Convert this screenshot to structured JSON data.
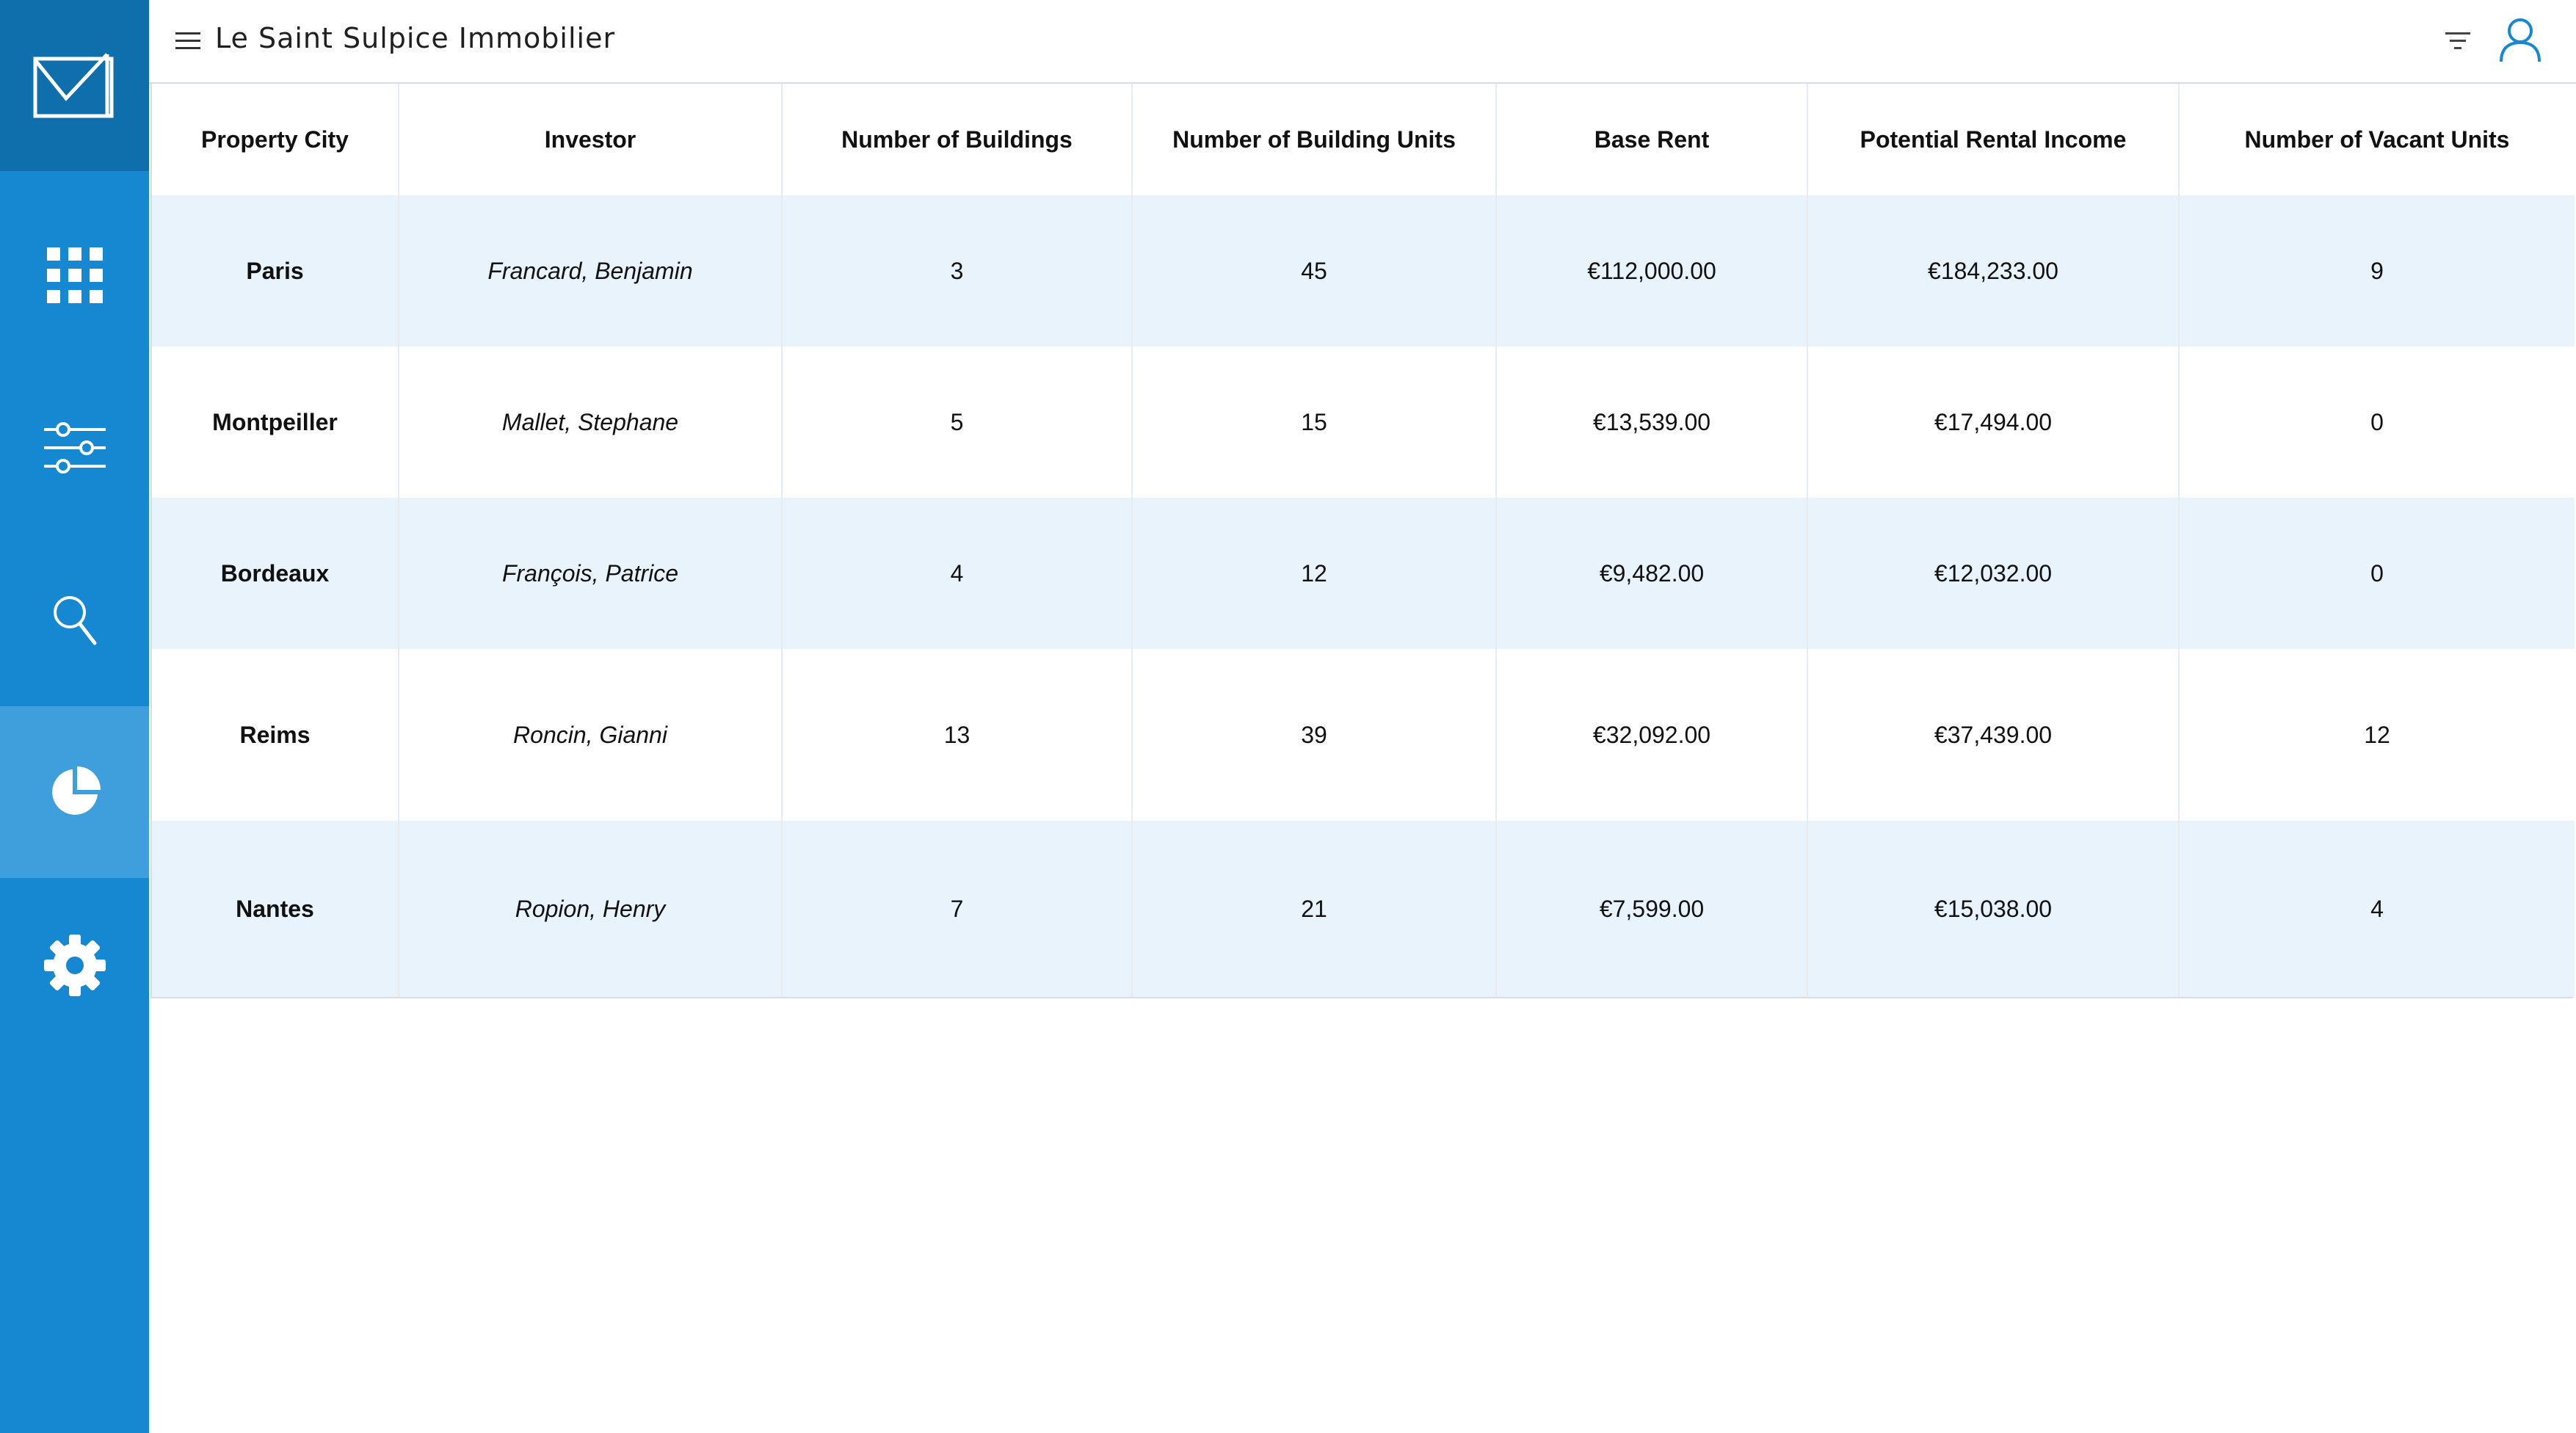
{
  "app": {
    "title": "Le Saint Sulpice Immobilier"
  },
  "sidebar": {
    "items": [
      {
        "name": "apps",
        "icon": "apps-grid-icon"
      },
      {
        "name": "filters",
        "icon": "sliders-icon"
      },
      {
        "name": "search",
        "icon": "search-icon"
      },
      {
        "name": "reports",
        "icon": "pie-chart-icon",
        "active": true
      },
      {
        "name": "settings",
        "icon": "gear-icon"
      }
    ]
  },
  "table": {
    "columns": [
      "Property City",
      "Investor",
      "Number of Buildings",
      "Number of Building Units",
      "Base Rent",
      "Potential Rental Income",
      "Number of Vacant Units"
    ],
    "rows": [
      {
        "city": "Paris",
        "investor": "Francard, Benjamin",
        "buildings": "3",
        "units": "45",
        "base_rent": "€112,000.00",
        "potential_income": "€184,233.00",
        "vacant": "9"
      },
      {
        "city": "Montpeiller",
        "investor": "Mallet, Stephane",
        "buildings": "5",
        "units": "15",
        "base_rent": "€13,539.00",
        "potential_income": "€17,494.00",
        "vacant": "0"
      },
      {
        "city": "Bordeaux",
        "investor": "François, Patrice",
        "buildings": "4",
        "units": "12",
        "base_rent": "€9,482.00",
        "potential_income": "€12,032.00",
        "vacant": "0"
      },
      {
        "city": "Reims",
        "investor": "Roncin, Gianni",
        "buildings": "13",
        "units": "39",
        "base_rent": "€32,092.00",
        "potential_income": "€37,439.00",
        "vacant": "12"
      },
      {
        "city": "Nantes",
        "investor": "Ropion, Henry",
        "buildings": "7",
        "units": "21",
        "base_rent": "€7,599.00",
        "potential_income": "€15,038.00",
        "vacant": "4"
      }
    ]
  },
  "colors": {
    "sidebar": "#1588d1",
    "sidebar_logo": "#0f6eac",
    "sidebar_active": "#3f9fdc",
    "row_alt": "#e8f3fc",
    "accent": "#1588d1"
  }
}
